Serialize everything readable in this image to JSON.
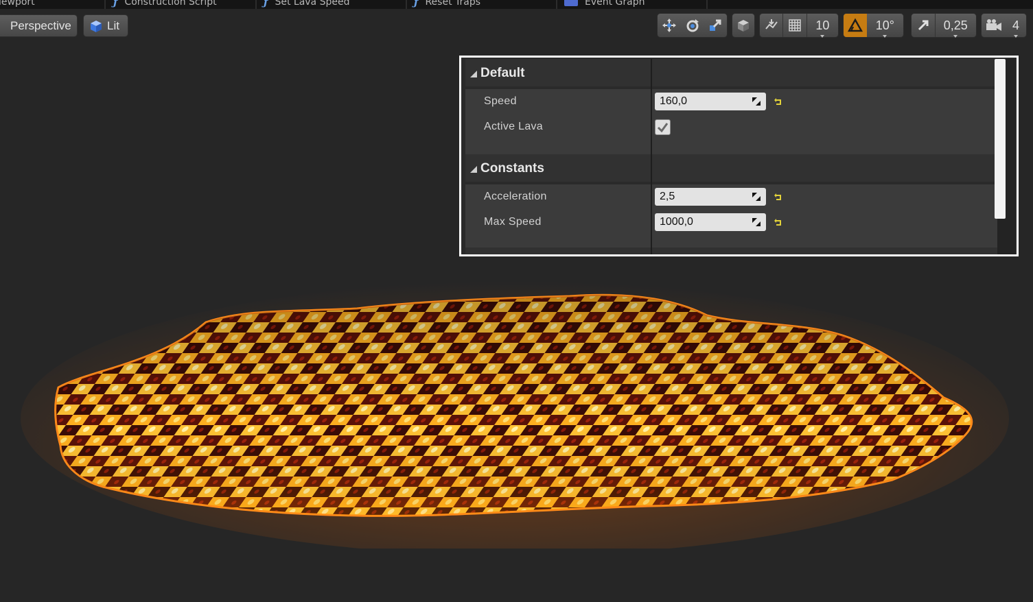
{
  "tabs": [
    {
      "label": "iewport",
      "icon": "none"
    },
    {
      "label": "Construction Script",
      "icon": "function-icon"
    },
    {
      "label": "Set Lava Speed",
      "icon": "function-icon"
    },
    {
      "label": "Reset Traps",
      "icon": "function-icon"
    },
    {
      "label": "Event Graph",
      "icon": "graph-icon"
    }
  ],
  "viewport": {
    "perspective_label": "Perspective",
    "lit_label": "Lit"
  },
  "toolbar": {
    "grid_snap_value": "10",
    "rotation_snap_value": "10°",
    "scale_snap_value": "0,25",
    "camera_speed_value": "4",
    "active_color": "#c67c12"
  },
  "details": {
    "categories": [
      {
        "label": "Default",
        "properties": [
          {
            "label": "Speed",
            "type": "number",
            "value": "160,0",
            "resettable": true
          },
          {
            "label": "Active Lava",
            "type": "checkbox",
            "checked": true,
            "resettable": false
          }
        ]
      },
      {
        "label": "Constants",
        "properties": [
          {
            "label": "Acceleration",
            "type": "number",
            "value": "2,5",
            "resettable": true
          },
          {
            "label": "Max Speed",
            "type": "number",
            "value": "1000,0",
            "resettable": true
          }
        ]
      }
    ],
    "reset_icon_color": "#e2d23a"
  }
}
